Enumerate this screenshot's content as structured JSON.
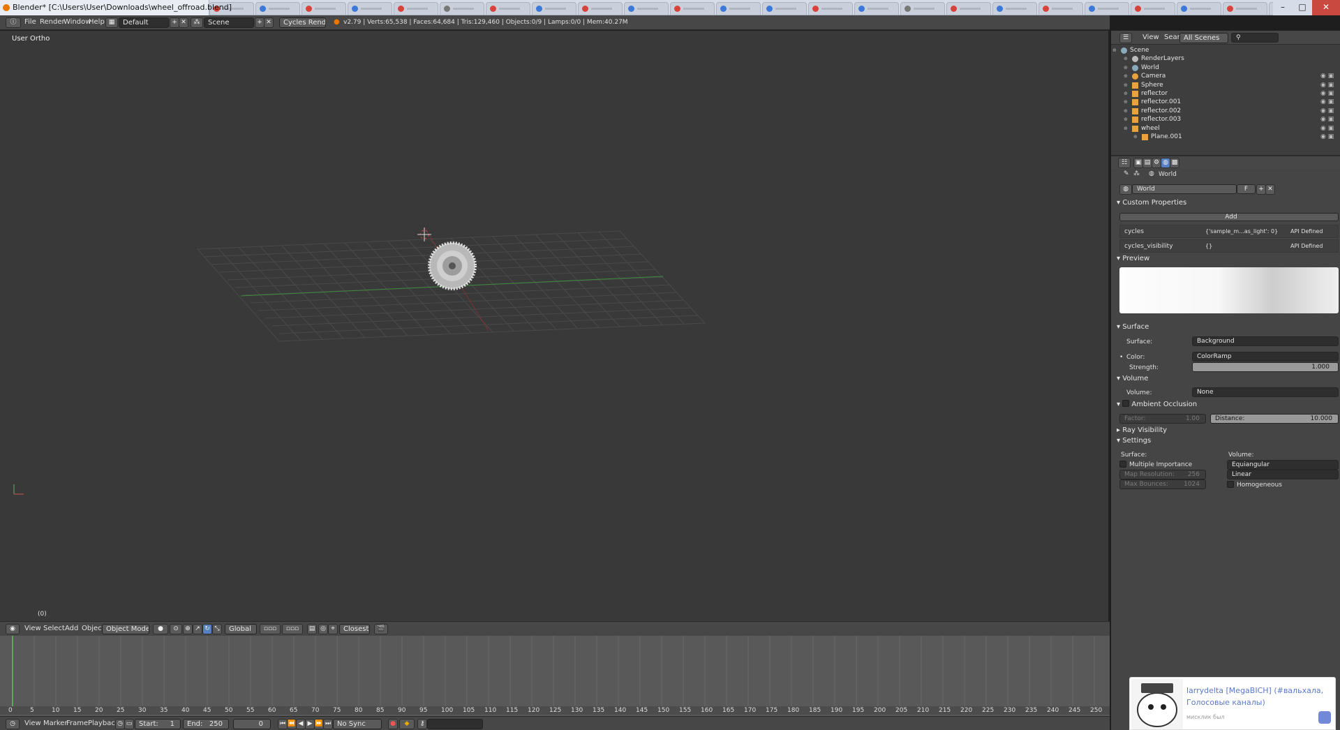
{
  "window": {
    "title": "Blender* [C:\\Users\\User\\Downloads\\wheel_offroad.blend]"
  },
  "menu": {
    "file": "File",
    "render": "Render",
    "window": "Window",
    "help": "Help"
  },
  "layout_name": "Default",
  "scene_name": "Scene",
  "render_engine": "Cycles Render",
  "stats": "v2.79 | Verts:65,538 | Faces:64,684 | Tris:129,460 | Objects:0/9 | Lamps:0/0 | Mem:40.27M",
  "viewport": {
    "label": "User Ortho",
    "frame": "(0)"
  },
  "viewport_header": {
    "view": "View",
    "select": "Select",
    "add": "Add",
    "object": "Object",
    "mode": "Object Mode",
    "orientation": "Global",
    "snap": "Closest"
  },
  "outliner": {
    "view": "View",
    "search": "Search",
    "filter": "All Scenes",
    "items": [
      {
        "label": "Scene"
      },
      {
        "label": "RenderLayers"
      },
      {
        "label": "World"
      },
      {
        "label": "Camera"
      },
      {
        "label": "Sphere"
      },
      {
        "label": "reflector"
      },
      {
        "label": "reflector.001"
      },
      {
        "label": "reflector.002"
      },
      {
        "label": "reflector.003"
      },
      {
        "label": "wheel"
      },
      {
        "label": "Plane.001"
      }
    ]
  },
  "properties": {
    "breadcrumb": "World",
    "world_name": "World",
    "fake_user": "F",
    "custom_props": {
      "title": "Custom Properties",
      "add": "Add",
      "rows": [
        {
          "name": "cycles",
          "value": "{'sample_m...as_light': 0}",
          "tag": "API Defined"
        },
        {
          "name": "cycles_visibility",
          "value": "{}",
          "tag": "API Defined"
        }
      ]
    },
    "preview": {
      "title": "Preview"
    },
    "surface": {
      "title": "Surface",
      "surface_label": "Surface:",
      "surface_value": "Background",
      "color_label": "Color:",
      "color_value": "ColorRamp",
      "strength_label": "Strength:",
      "strength_value": "1.000"
    },
    "volume": {
      "title": "Volume",
      "volume_label": "Volume:",
      "volume_value": "None"
    },
    "ao": {
      "title": "Ambient Occlusion",
      "factor_label": "Factor:",
      "factor_value": "1.00",
      "distance_label": "Distance:",
      "distance_value": "10.000"
    },
    "ray_visibility": {
      "title": "Ray Visibility"
    },
    "settings": {
      "title": "Settings",
      "surface_label": "Surface:",
      "volume_label": "Volume:",
      "multiple_importance": "Multiple Importance",
      "map_resolution_label": "Map Resolution:",
      "map_resolution_value": "256",
      "max_bounces_label": "Max Bounces:",
      "max_bounces_value": "1024",
      "sampling": "Equiangular",
      "interpolation": "Linear",
      "homogeneous": "Homogeneous"
    }
  },
  "timeline": {
    "ticks": [
      "0",
      "5",
      "10",
      "15",
      "20",
      "25",
      "30",
      "35",
      "40",
      "45",
      "50",
      "55",
      "60",
      "65",
      "70",
      "75",
      "80",
      "85",
      "90",
      "95",
      "100",
      "105",
      "110",
      "115",
      "120",
      "125",
      "130",
      "135",
      "140",
      "145",
      "150",
      "155",
      "160",
      "165",
      "170",
      "175",
      "180",
      "185",
      "190",
      "195",
      "200",
      "205",
      "210",
      "215",
      "220",
      "225",
      "230",
      "235",
      "240",
      "245",
      "250"
    ],
    "view": "View",
    "marker": "Marker",
    "frame": "Frame",
    "playback": "Playback",
    "start_label": "Start:",
    "start": "1",
    "end_label": "End:",
    "end": "250",
    "current": "0",
    "sync": "No Sync"
  },
  "notification": {
    "title": "larrydelta [MegaBICH] (#вальхала, Голосовые каналы)",
    "subtitle": "мисклик был"
  }
}
